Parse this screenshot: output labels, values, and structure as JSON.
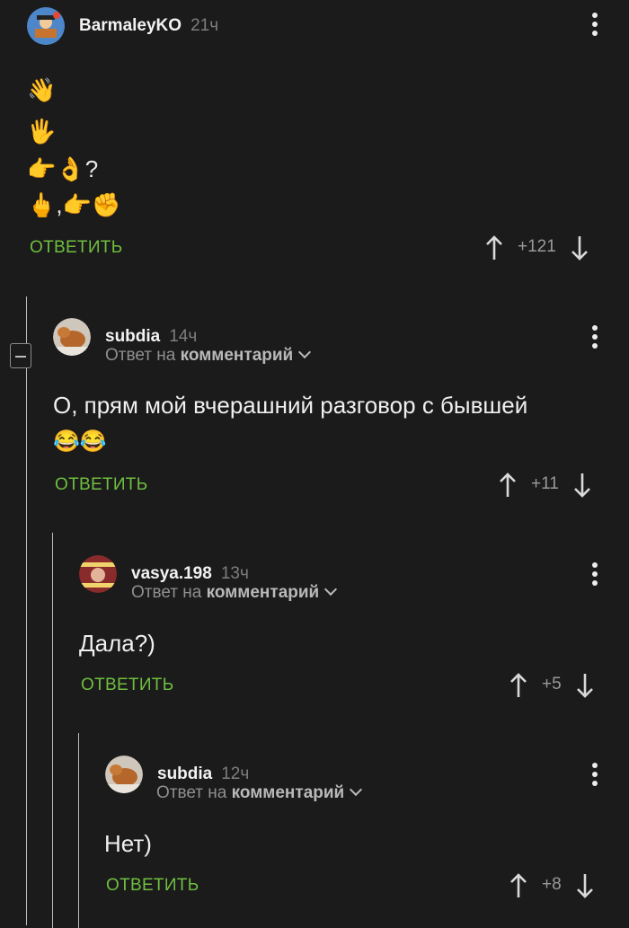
{
  "reply_label": "ОТВЕТИТЬ",
  "reply_to_prefix": "Ответ на",
  "reply_to_link": "комментарий",
  "comments": [
    {
      "username": "BarmaleyKO",
      "time": "21ч",
      "emoji_lines": [
        "👋",
        "🖐",
        "👉👌?",
        "🖕,👉✊"
      ],
      "score": "+121"
    },
    {
      "username": "subdia",
      "time": "14ч",
      "text": "О, прям мой вчерашний разговор с бывшей",
      "text_emoji": "😂😂",
      "score": "+11"
    },
    {
      "username": "vasya.198",
      "time": "13ч",
      "text": "Дала?)",
      "score": "+5"
    },
    {
      "username": "subdia",
      "time": "12ч",
      "text": "Нет)",
      "score": "+8"
    }
  ],
  "colors": {
    "background": "#1b1b1b",
    "reply_green": "#6fbf3f",
    "muted": "#8f8f8f"
  }
}
